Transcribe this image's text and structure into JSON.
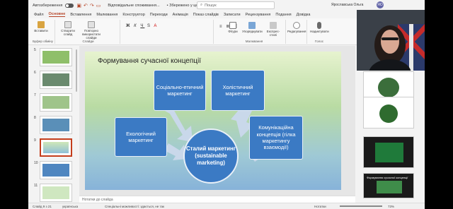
{
  "titlebar": {
    "autosave_label": "Автозбереження",
    "doc_title": "Відповідальне споживання...",
    "save_state": "• Збережено у цей ПК",
    "search_placeholder": "Пошук",
    "user_name": "Ярославська Ольга",
    "user_initials": "ЯО"
  },
  "tabs": [
    {
      "label": "Файл"
    },
    {
      "label": "Основне"
    },
    {
      "label": "Вставлення"
    },
    {
      "label": "Малювання"
    },
    {
      "label": "Конструктор"
    },
    {
      "label": "Переходи"
    },
    {
      "label": "Анімація"
    },
    {
      "label": "Показ слайдів"
    },
    {
      "label": "Записати"
    },
    {
      "label": "Рецензування"
    },
    {
      "label": "Подання"
    },
    {
      "label": "Довідка"
    }
  ],
  "ribbon": {
    "paste": "Вставити",
    "clipboard": "Буфер обміну",
    "new_slide": "Створити слайд",
    "reuse_slides": "Повторно використати слайди",
    "slides": "Слайди",
    "shapes": "Фігури",
    "arrange": "Упорядкувати",
    "quick_styles": "Експрес-стилі",
    "drawing": "Малювання",
    "editing": "Редагування",
    "dictate": "Надиктувати",
    "voice": "Голос"
  },
  "thumbnails": [
    {
      "num": "5",
      "color": "#8fbf6a"
    },
    {
      "num": "6",
      "color": "#6a8a6e"
    },
    {
      "num": "7",
      "color": "#9fc48a"
    },
    {
      "num": "8",
      "color": "#5a8fb8"
    },
    {
      "num": "9",
      "color": "#a9d0e0"
    },
    {
      "num": "10",
      "color": "#4f86c0"
    },
    {
      "num": "11",
      "color": "#cfe7c0"
    }
  ],
  "slide": {
    "title": "Формування сучасної концепції",
    "nodes": {
      "social": "Соціально-етичний маркетинг",
      "holistic": "Холістичний маркетинг",
      "eco": "Екологічний маркетинг",
      "comm": "Комунікаційна концепція (гілка маркетингу взаємодії)",
      "center": "Сталий маркетинг (sustainable marketing)"
    },
    "colors": {
      "node": "#3b7ac4",
      "arrow": "#c9d8ea"
    }
  },
  "notes_placeholder": "Нотатки до слайда",
  "designer": {
    "last_title": "Формування сучасної концепції"
  },
  "statusbar": {
    "slide_count": "Слайд 9 з 21",
    "language": "українська",
    "accessibility": "Спеціальні можливості: здається, не так",
    "notes": "Нотатки",
    "zoom": "73%"
  }
}
